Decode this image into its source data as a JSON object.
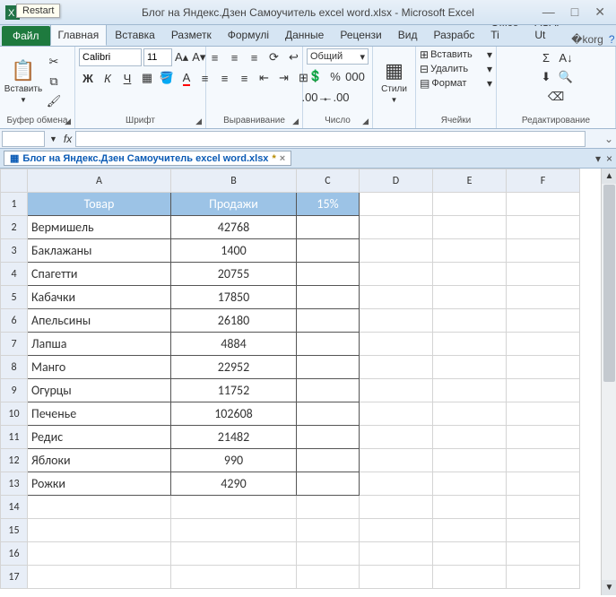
{
  "window": {
    "title": "Блог на Яндекс.Дзен Самоучитель excel word.xlsx  -  Microsoft Excel",
    "restart_tooltip": "Restart"
  },
  "tabs": {
    "file": "Файл",
    "items": [
      "Главная",
      "Вставка",
      "Разметк",
      "Формулі",
      "Данные",
      "Рецензи",
      "Вид",
      "Разрабс",
      "Office Ti",
      "ASAP Ut"
    ],
    "active_index": 0
  },
  "ribbon": {
    "clipboard": {
      "paste": "Вставить",
      "label": "Буфер обмена"
    },
    "font": {
      "name": "Calibri",
      "size": "11",
      "label": "Шрифт"
    },
    "alignment": {
      "label": "Выравнивание"
    },
    "number": {
      "format": "Общий",
      "label": "Число"
    },
    "styles": {
      "btn": "Стили",
      "label": ""
    },
    "cells": {
      "insert": "Вставить",
      "delete": "Удалить",
      "format": "Формат",
      "label": "Ячейки"
    },
    "editing": {
      "label": "Редактирование"
    }
  },
  "formula_bar": {
    "name_box": "",
    "formula": ""
  },
  "workbook_tab": {
    "name": "Блог на Яндекс.Дзен Самоучитель excel word.xlsx",
    "dirty": "*"
  },
  "chart_data": {
    "type": "table",
    "columns": [
      "Товар",
      "Продажи",
      "15%"
    ],
    "rows": [
      [
        "Вермишель",
        42768,
        ""
      ],
      [
        "Баклажаны",
        1400,
        ""
      ],
      [
        "Спагетти",
        20755,
        ""
      ],
      [
        "Кабачки",
        17850,
        ""
      ],
      [
        "Апельсины",
        26180,
        ""
      ],
      [
        "Лапша",
        4884,
        ""
      ],
      [
        "Манго",
        22952,
        ""
      ],
      [
        "Огурцы",
        11752,
        ""
      ],
      [
        "Печенье",
        102608,
        ""
      ],
      [
        "Редис",
        21482,
        ""
      ],
      [
        "Яблоки",
        990,
        ""
      ],
      [
        "Рожки",
        4290,
        ""
      ]
    ]
  },
  "grid": {
    "col_letters": [
      "A",
      "B",
      "C",
      "D",
      "E",
      "F"
    ],
    "visible_rows": 17
  }
}
